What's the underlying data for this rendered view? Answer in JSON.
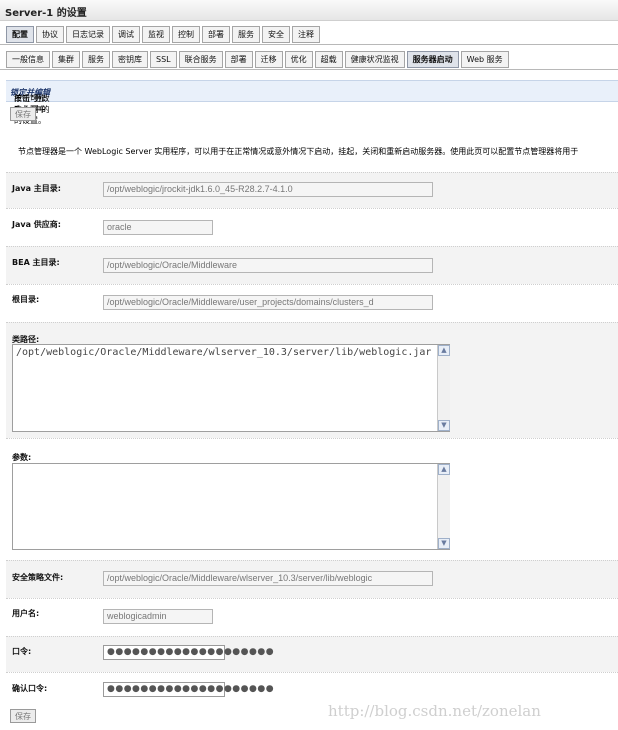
{
  "window": {
    "title": "Server-1 的设置"
  },
  "tabs_primary": [
    "配置",
    "协议",
    "日志记录",
    "调试",
    "监视",
    "控制",
    "部署",
    "服务",
    "安全",
    "注释"
  ],
  "tabs_secondary": [
    "一般信息",
    "集群",
    "服务",
    "密钥库",
    "SSL",
    "联合服务",
    "部署",
    "迁移",
    "优化",
    "超载",
    "健康状况监视",
    "服务器启动",
    "Web 服务"
  ],
  "message": {
    "prefix": "单击\"更改中心\"中的",
    "link": "锁定并编辑",
    "suffix": "按钮可修改此页中的设置。"
  },
  "buttons": {
    "save": "保存"
  },
  "description": "节点管理器是一个 WebLogic Server 实用程序，可以用于在正常情况或意外情况下启动，挂起，关闭和重新启动服务器。使用此页可以配置节点管理器将用于",
  "fields": {
    "java_home": {
      "label": "Java 主目录:",
      "value": "/opt/weblogic/jrockit-jdk1.6.0_45-R28.2.7-4.1.0"
    },
    "java_vendor": {
      "label": "Java 供应商:",
      "value": "oracle"
    },
    "bea_home": {
      "label": "BEA 主目录:",
      "value": "/opt/weblogic/Oracle/Middleware"
    },
    "root_dir": {
      "label": "根目录:",
      "value": "/opt/weblogic/Oracle/Middleware/user_projects/domains/clusters_d"
    },
    "classpath": {
      "label": "类路径:",
      "value": "/opt/weblogic/Oracle/Middleware/wlserver_10.3/server/lib/weblogic.jar"
    },
    "arguments": {
      "label": "参数:",
      "value": ""
    },
    "security_policy": {
      "label": "安全策略文件:",
      "value": "/opt/weblogic/Oracle/Middleware/wlserver_10.3/server/lib/weblogic"
    },
    "username": {
      "label": "用户名:",
      "value": "weblogicadmin"
    },
    "password": {
      "label": "口令:",
      "value": "●●●●●●●●●●●●●●●●●●●●"
    },
    "confirm_password": {
      "label": "确认口令:",
      "value": "●●●●●●●●●●●●●●●●●●●●"
    }
  },
  "watermark": "http://blog.csdn.net/zonelan"
}
